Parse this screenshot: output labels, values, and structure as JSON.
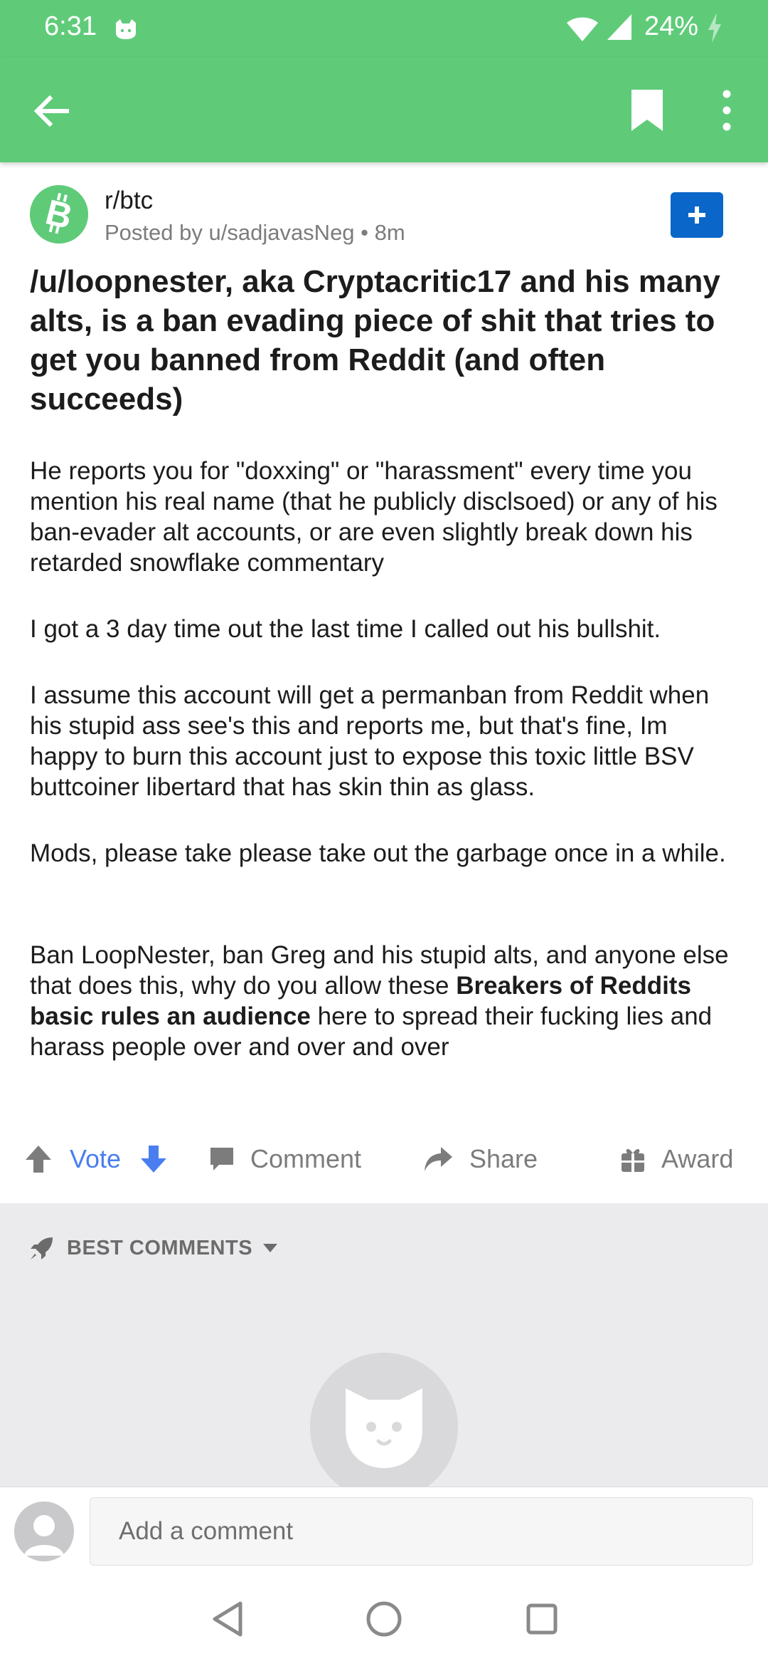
{
  "status_bar": {
    "time": "6:31",
    "battery": "24%"
  },
  "app_bar": {
    "back_icon": "arrow-left-icon",
    "bookmark_icon": "bookmark-icon",
    "more_icon": "more-vertical-icon"
  },
  "post": {
    "subreddit": "r/btc",
    "meta": "Posted by u/sadjavasNeg • 8m",
    "title": "/u/loopnester, aka Cryptacritic17 and his many alts, is a ban evading piece of shit that tries to get you banned from Reddit (and often succeeds)",
    "body": [
      "He reports you for \"doxxing\" or \"harassment\" every time you mention his real name (that he publicly disclsoed) or any of his ban-evader alt accounts, or are even slightly break down his retarded snowflake commentary",
      "I got a 3 day time out the last time I called out his bullshit.",
      "I assume this account will get a permanban from Reddit when his stupid ass see's this and reports me, but that's fine, Im happy to burn this account just to expose this toxic little BSV buttcoiner libertard that has skin thin as glass.",
      "Mods, please take please take out the garbage once in a while."
    ],
    "last_paragraph": {
      "before": "Ban LoopNester, ban Greg and his stupid alts, and anyone else that does this, why do you allow these ",
      "bold": "Breakers of Reddits basic rules an audience",
      "after": " here to spread their fucking lies and harass people over and over and over"
    }
  },
  "actions": {
    "vote": "Vote",
    "comment": "Comment",
    "share": "Share",
    "award": "Award"
  },
  "comments": {
    "sort_label": "BEST COMMENTS"
  },
  "composer": {
    "placeholder": "Add a comment"
  },
  "colors": {
    "brand_green": "#5fcb79",
    "join_blue": "#0a66c8",
    "vote_blue": "#4a7ef0"
  }
}
